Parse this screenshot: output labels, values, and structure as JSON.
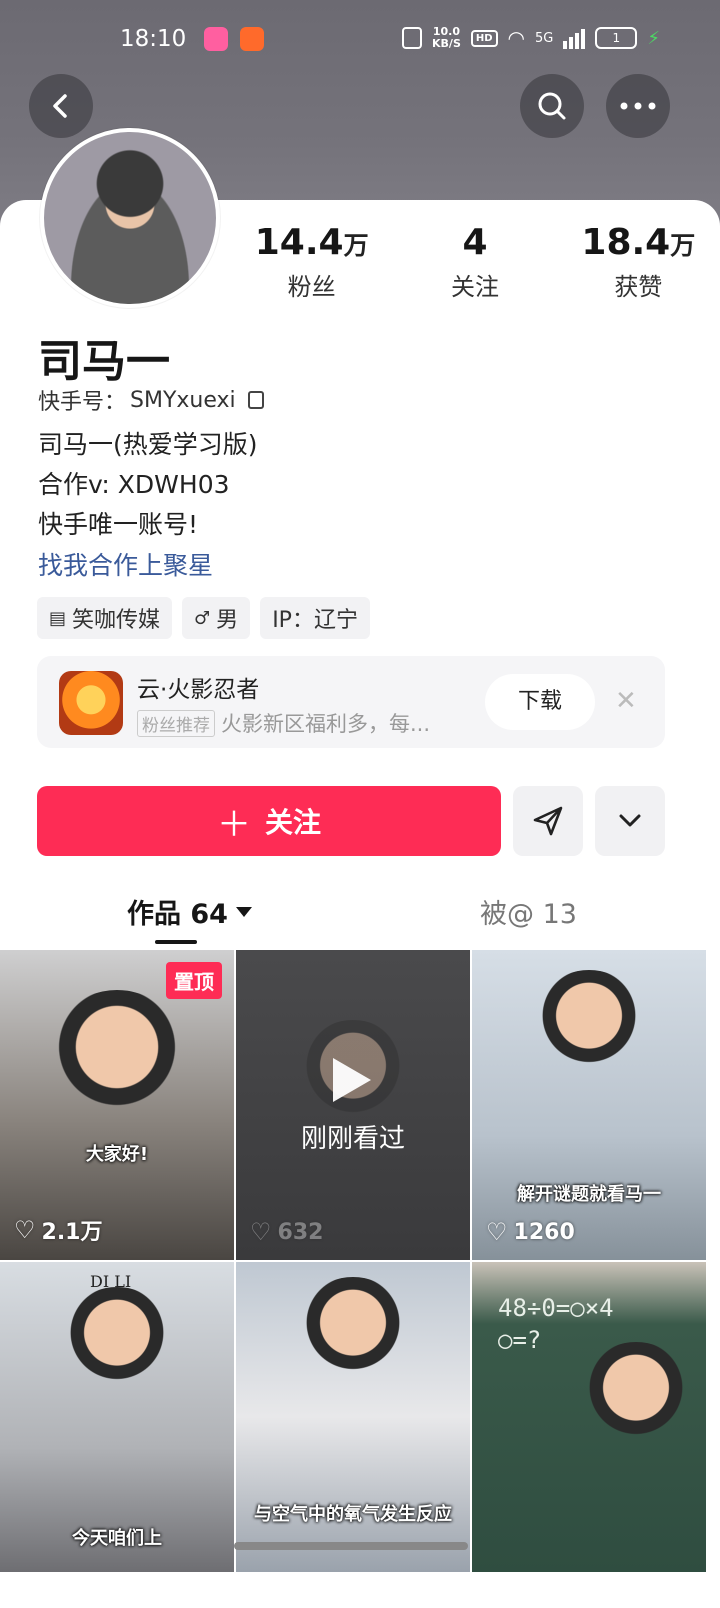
{
  "status_bar": {
    "time": "18:10",
    "net_speed_value": "10.0",
    "net_speed_unit": "KB/S",
    "hd": "HD",
    "network": "5G",
    "battery": "1"
  },
  "header": {
    "back_icon": "chevron-left-icon",
    "search_icon": "search-icon",
    "more_icon": "ellipsis-icon"
  },
  "profile": {
    "name": "司马一",
    "account_id_label": "快手号：",
    "account_id": "SMYxuexi",
    "bio_lines": [
      "司马一(热爱学习版)",
      "合作v: XDWH03",
      "快手唯一账号!"
    ],
    "bio_link": "找我合作上聚星",
    "stats": [
      {
        "value": "14.4",
        "unit": "万",
        "label": "粉丝"
      },
      {
        "value": "4",
        "unit": "",
        "label": "关注"
      },
      {
        "value": "18.4",
        "unit": "万",
        "label": "获赞"
      }
    ],
    "tags": [
      {
        "icon": "building-icon",
        "label": "笑咖传媒"
      },
      {
        "icon": "male-icon",
        "label": "男"
      },
      {
        "icon": "",
        "label": "IP：辽宁"
      }
    ]
  },
  "ad": {
    "title": "云·火影忍者",
    "badge": "粉丝推荐",
    "subtitle": "火影新区福利多，每...",
    "download": "下载",
    "close_icon": "close-icon"
  },
  "actions": {
    "follow": "关注",
    "share_icon": "send-icon",
    "dropdown_icon": "chevron-down-icon"
  },
  "tabs": {
    "works": "作品 64",
    "mentions": "被@ 13"
  },
  "grid": [
    {
      "pinned": "置顶",
      "caption": "大家好!",
      "likes": "2.1万"
    },
    {
      "watched": "刚刚看过",
      "likes": "632"
    },
    {
      "caption": "解开谜题就看马一",
      "likes": "1260"
    },
    {
      "board": "DI LI",
      "caption": "今天咱们上"
    },
    {
      "caption": "与空气中的氧气发生反应"
    },
    {
      "board_line1": "48÷0=○×4",
      "board_line2": "○=?"
    }
  ],
  "colors": {
    "accent": "#fe2c55",
    "link": "#3a5a9a"
  }
}
